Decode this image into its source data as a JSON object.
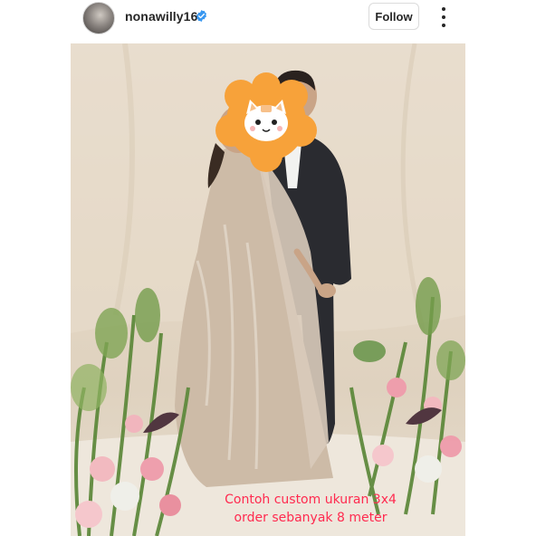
{
  "post": {
    "username": "nonawilly16",
    "verified_icon": "verified-badge-icon",
    "follow_label": "Follow",
    "more_icon": "more-options-icon",
    "accent_color": "#3897f0",
    "image": {
      "sticker_icon": "cat-face-icon",
      "overlay_text_line1": "Contoh custom ukuran 3x4",
      "overlay_text_line2": "order sebanyak 8 meter",
      "overlay_text_color": "#ff2a4f"
    }
  }
}
